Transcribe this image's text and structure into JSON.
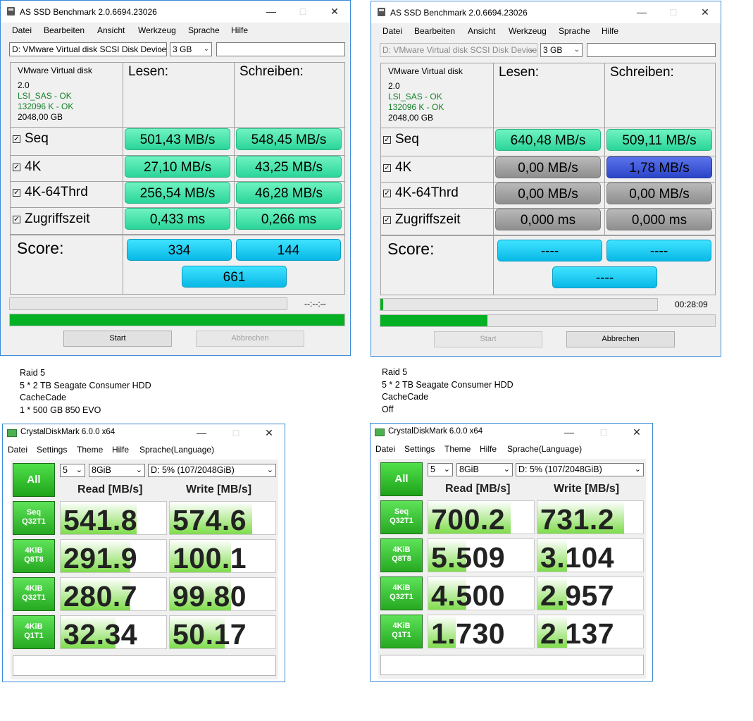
{
  "asssd": [
    {
      "title": "AS SSD Benchmark 2.0.6694.23026",
      "menu": [
        "Datei",
        "Bearbeiten",
        "Ansicht",
        "Werkzeug",
        "Sprache",
        "Hilfe"
      ],
      "drive": "D: VMware Virtual disk SCSI Disk Device",
      "size": "3 GB",
      "info": [
        "VMware Virtual disk",
        "2.0",
        "LSI_SAS - OK",
        "132096 K - OK",
        "2048,00 GB"
      ],
      "read_header": "Lesen:",
      "write_header": "Schreiben:",
      "rows": [
        {
          "label": "Seq",
          "read": "501,43 MB/s",
          "write": "548,45 MB/s"
        },
        {
          "label": "4K",
          "read": "27,10 MB/s",
          "write": "43,25 MB/s"
        },
        {
          "label": "4K-64Thrd",
          "read": "256,54 MB/s",
          "write": "46,28 MB/s"
        },
        {
          "label": "Zugriffszeit",
          "read": "0,433 ms",
          "write": "0,266 ms"
        }
      ],
      "score_label": "Score:",
      "score_read": "334",
      "score_write": "144",
      "score_total": "661",
      "time": "--:--:--",
      "progress_top": 0,
      "progress_bottom": 1.0,
      "start": "Start",
      "cancel": "Abbrechen"
    },
    {
      "title": "AS SSD Benchmark 2.0.6694.23026",
      "menu": [
        "Datei",
        "Bearbeiten",
        "Ansicht",
        "Werkzeug",
        "Sprache",
        "Hilfe"
      ],
      "drive": "D: VMware Virtual disk SCSI Disk Device",
      "size": "3 GB",
      "info": [
        "VMware Virtual disk",
        "2.0",
        "LSI_SAS - OK",
        "132096 K - OK",
        "2048,00 GB"
      ],
      "read_header": "Lesen:",
      "write_header": "Schreiben:",
      "rows": [
        {
          "label": "Seq",
          "read": "640,48 MB/s",
          "write": "509,11 MB/s"
        },
        {
          "label": "4K",
          "read": "0,00 MB/s",
          "write": "1,78 MB/s"
        },
        {
          "label": "4K-64Thrd",
          "read": "0,00 MB/s",
          "write": "0,00 MB/s"
        },
        {
          "label": "Zugriffszeit",
          "read": "0,000 ms",
          "write": "0,000 ms"
        }
      ],
      "score_label": "Score:",
      "score_read": "----",
      "score_write": "----",
      "score_total": "----",
      "time": "00:28:09",
      "progress_top": 0.01,
      "progress_bottom": 0.32,
      "start": "Start",
      "cancel": "Abbrechen"
    }
  ],
  "notes": [
    [
      "Raid 5",
      "5 * 2 TB Seagate Consumer HDD",
      "CacheCade",
      "1 * 500 GB 850 EVO"
    ],
    [
      "Raid 5",
      "5 * 2 TB Seagate Consumer HDD",
      "CacheCade",
      "Off"
    ]
  ],
  "cdm": [
    {
      "title": "CrystalDiskMark 6.0.0 x64",
      "menu": [
        "Datei",
        "Settings",
        "Theme",
        "Hilfe",
        "Sprache(Language)"
      ],
      "all": "All",
      "count": "5",
      "size": "8GiB",
      "drive": "D: 5% (107/2048GiB)",
      "read_header": "Read [MB/s]",
      "write_header": "Write [MB/s]",
      "rows": [
        {
          "l1": "Seq",
          "l2": "Q32T1",
          "read": "541.8",
          "write": "574.6",
          "read_bar": 0.72,
          "write_bar": 0.78
        },
        {
          "l1": "4KiB",
          "l2": "Q8T8",
          "read": "291.9",
          "write": "100.1",
          "read_bar": 0.66,
          "write_bar": 0.58
        },
        {
          "l1": "4KiB",
          "l2": "Q32T1",
          "read": "280.7",
          "write": "99.80",
          "read_bar": 0.66,
          "write_bar": 0.58
        },
        {
          "l1": "4KiB",
          "l2": "Q1T1",
          "read": "32.34",
          "write": "50.17",
          "read_bar": 0.52,
          "write_bar": 0.52
        }
      ]
    },
    {
      "title": "CrystalDiskMark 6.0.0 x64",
      "menu": [
        "Datei",
        "Settings",
        "Theme",
        "Hilfe",
        "Sprache(Language)"
      ],
      "all": "All",
      "count": "5",
      "size": "8GiB",
      "drive": "D: 5% (107/2048GiB)",
      "read_header": "Read [MB/s]",
      "write_header": "Write [MB/s]",
      "rows": [
        {
          "l1": "Seq",
          "l2": "Q32T1",
          "read": "700.2",
          "write": "731.2",
          "read_bar": 0.78,
          "write_bar": 0.82
        },
        {
          "l1": "4KiB",
          "l2": "Q8T8",
          "read": "5.509",
          "write": "3.104",
          "read_bar": 0.36,
          "write_bar": 0.28
        },
        {
          "l1": "4KiB",
          "l2": "Q32T1",
          "read": "4.500",
          "write": "2.957",
          "read_bar": 0.36,
          "write_bar": 0.28
        },
        {
          "l1": "4KiB",
          "l2": "Q1T1",
          "read": "1.730",
          "write": "2.137",
          "read_bar": 0.26,
          "write_bar": 0.28
        }
      ]
    }
  ],
  "colors": {
    "green_pill": "#2bd59a",
    "gray_pill": "#8e8e8e",
    "blue_pill": "#2b45c9",
    "score_pill": "#08b8e6",
    "progress": "#06b025",
    "cdm_green": "#26a921"
  }
}
